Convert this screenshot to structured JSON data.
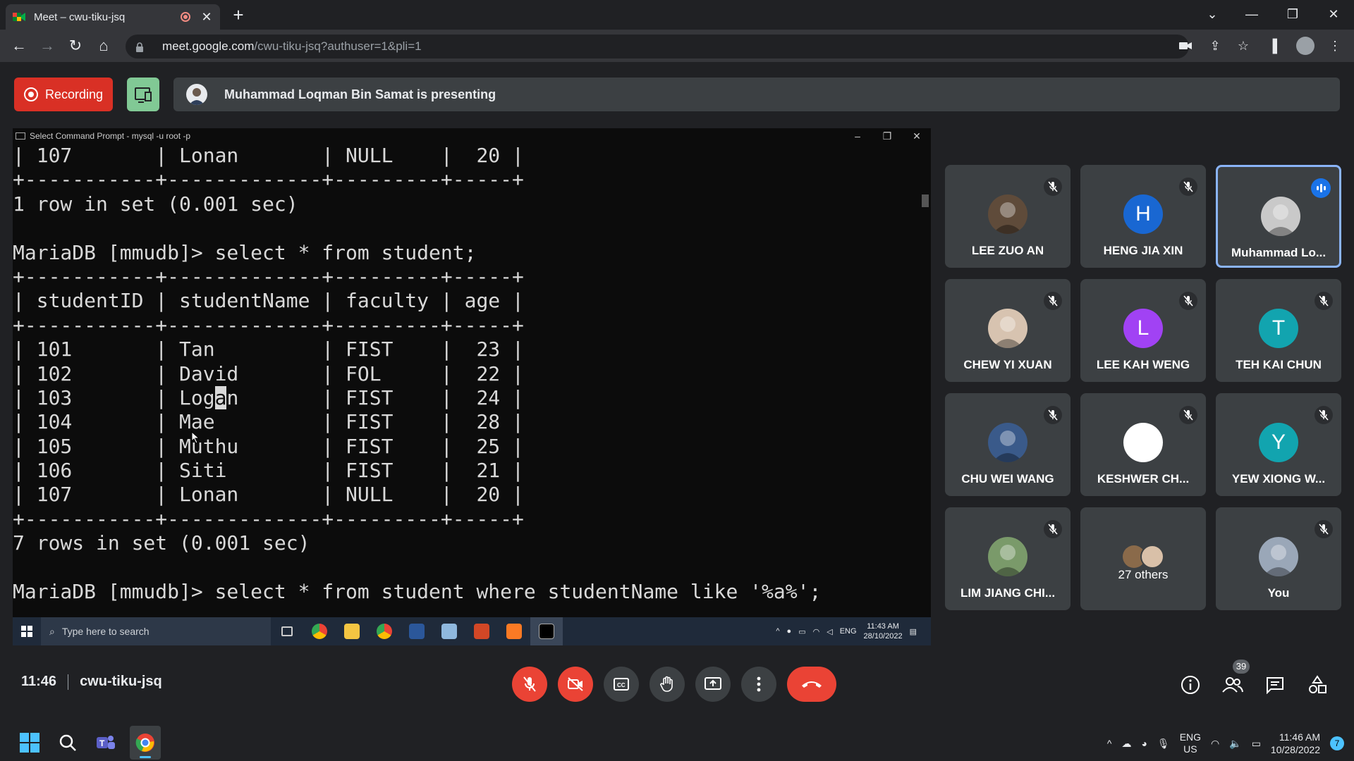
{
  "browser": {
    "tab_title": "Meet – cwu-tiku-jsq",
    "url_host": "meet.google.com",
    "url_path": "/cwu-tiku-jsq?authuser=1&pli=1"
  },
  "meet": {
    "recording_label": "Recording",
    "presenting_text": "Muhammad Loqman Bin Samat is presenting",
    "time": "11:46",
    "meeting_code": "cwu-tiku-jsq",
    "people_count": "39"
  },
  "shared_screen": {
    "window_title": "Select Command Prompt - mysql  -u root -p",
    "console_lines": [
      "| 107       | Lonan       | NULL    |  20 |",
      "+-----------+-------------+---------+-----+",
      "1 row in set (0.001 sec)",
      "",
      "MariaDB [mmudb]> select * from student;",
      "+-----------+-------------+---------+-----+",
      "| studentID | studentName | faculty | age |",
      "+-----------+-------------+---------+-----+",
      "| 101       | Tan         | FIST    |  23 |",
      "| 102       | David       | FOL     |  22 |",
      "| 103       | Logan       | FIST    |  24 |",
      "| 104       | Mae         | FIST    |  28 |",
      "| 105       | Muthu       | FIST    |  25 |",
      "| 106       | Siti        | FIST    |  21 |",
      "| 107       | Lonan       | NULL    |  20 |",
      "+-----------+-------------+---------+-----+",
      "7 rows in set (0.001 sec)",
      "",
      "MariaDB [mmudb]> select * from student where studentName like '%a%';"
    ],
    "taskbar_search_placeholder": "Type here to search",
    "tray_lang": "ENG",
    "clock_time": "11:43 AM",
    "clock_date": "28/10/2022"
  },
  "participants": [
    {
      "name": "LEE ZUO AN",
      "initial": "",
      "color": "#5f4b3a",
      "muted": true,
      "photo": true
    },
    {
      "name": "HENG JIA XIN",
      "initial": "H",
      "color": "#1967d2",
      "muted": true,
      "photo": false
    },
    {
      "name": "Muhammad Lo...",
      "initial": "",
      "color": "#c9c9c9",
      "muted": false,
      "photo": true,
      "speaking": true
    },
    {
      "name": "CHEW YI XUAN",
      "initial": "",
      "color": "#d7c3b0",
      "muted": true,
      "photo": true
    },
    {
      "name": "LEE KAH WENG",
      "initial": "L",
      "color": "#a142f4",
      "muted": true,
      "photo": false
    },
    {
      "name": "TEH KAI CHUN",
      "initial": "T",
      "color": "#12a4af",
      "muted": true,
      "photo": false
    },
    {
      "name": "CHU WEI WANG",
      "initial": "",
      "color": "#3a5a8a",
      "muted": true,
      "photo": true
    },
    {
      "name": "KESHWER CH...",
      "initial": "",
      "color": "#ffffff",
      "muted": true,
      "photo": true
    },
    {
      "name": "YEW XIONG W...",
      "initial": "Y",
      "color": "#12a4af",
      "muted": true,
      "photo": false
    },
    {
      "name": "LIM JIANG CHI...",
      "initial": "",
      "color": "#7a9a6a",
      "muted": true,
      "photo": true
    },
    {
      "name": "27 others",
      "initial": "",
      "color": "",
      "muted": false,
      "photo": false,
      "group": true
    },
    {
      "name": "You",
      "initial": "",
      "color": "#9aa7b8",
      "muted": true,
      "photo": true
    }
  ],
  "os": {
    "lang": "ENG",
    "region": "US",
    "time": "11:46 AM",
    "date": "10/28/2022",
    "notifications": "7"
  }
}
